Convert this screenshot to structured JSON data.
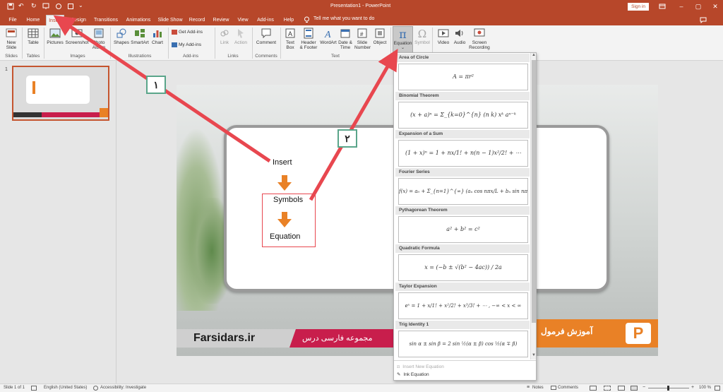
{
  "window": {
    "title": "Presentation1 - PowerPoint",
    "sign_in": "Sign in"
  },
  "tabs": [
    "File",
    "Home",
    "Insert",
    "Design",
    "Transitions",
    "Animations",
    "Slide Show",
    "Record",
    "Review",
    "View",
    "Add-ins",
    "Help"
  ],
  "active_tab": "Insert",
  "tell_me": "Tell me what you want to do",
  "ribbon": {
    "new_slide": "New Slide",
    "table": "Table",
    "pictures": "Pictures",
    "screenshot": "Screenshot",
    "photo_album": "Photo Album",
    "shapes": "Shapes",
    "smartart": "SmartArt",
    "chart": "Chart",
    "get_addins": "Get Add-ins",
    "my_addins": "My Add-ins",
    "link": "Link",
    "action": "Action",
    "comment": "Comment",
    "text_box": "Text Box",
    "header_footer": "Header & Footer",
    "wordart": "WordArt",
    "date_time": "Date & Time",
    "slide_number": "Slide Number",
    "object": "Object",
    "equation": "Equation",
    "symbol": "Symbol",
    "video": "Video",
    "audio": "Audio",
    "screen_recording": "Screen Recording",
    "groups": {
      "slides": "Slides",
      "tables": "Tables",
      "images": "Images",
      "illustrations": "Illustrations",
      "addins": "Add-ins",
      "links": "Links",
      "comments": "Comments",
      "text": "Text"
    }
  },
  "thumbnail": {
    "number": "1"
  },
  "slide": {
    "insert": "Insert",
    "symbols": "Symbols",
    "equation": "Equation",
    "brand": "Farsidars.ir",
    "collection": "مجموعه فارسی درس",
    "title_fa": "آموزش فرمول"
  },
  "badges": {
    "one": "۱",
    "two": "۲"
  },
  "equation_gallery": {
    "items": [
      {
        "title": "Area of Circle",
        "formula": "A = πr²"
      },
      {
        "title": "Binomial Theorem",
        "formula": "(x + a)ⁿ = Σ_{k=0}^{n} (n k) xᵏ aⁿ⁻ᵏ"
      },
      {
        "title": "Expansion of a Sum",
        "formula": "(1 + x)ⁿ = 1 + nx/1! + n(n − 1)x²/2! + ⋯"
      },
      {
        "title": "Fourier Series",
        "formula": "f(x) = a₀ + Σ_{n=1}^{∞} (aₙ cos nπx/L + bₙ sin nπx/L)"
      },
      {
        "title": "Pythagorean Theorem",
        "formula": "a² + b² = c²"
      },
      {
        "title": "Quadratic Formula",
        "formula": "x = (−b ± √(b² − 4ac)) / 2a"
      },
      {
        "title": "Taylor Expansion",
        "formula": "eˣ = 1 + x/1! + x²/2! + x³/3! + ⋯ ,    −∞ < x < ∞"
      },
      {
        "title": "Trig Identity 1",
        "formula": "sin α ± sin β = 2 sin ½(α ± β) cos ½(α ∓ β)"
      }
    ],
    "insert_new": "Insert New Equation",
    "ink_equation": "Ink Equation"
  },
  "status": {
    "slide_of": "Slide 1 of 1",
    "language": "English (United States)",
    "accessibility": "Accessibility: Investigate",
    "notes": "Notes",
    "comments": "Comments",
    "zoom": "100 %"
  },
  "colors": {
    "accent": "#b7472a",
    "arrow": "#e8474f",
    "orange": "#e98126",
    "crimson": "#c81e4c",
    "badge_border": "#5aa58a"
  }
}
